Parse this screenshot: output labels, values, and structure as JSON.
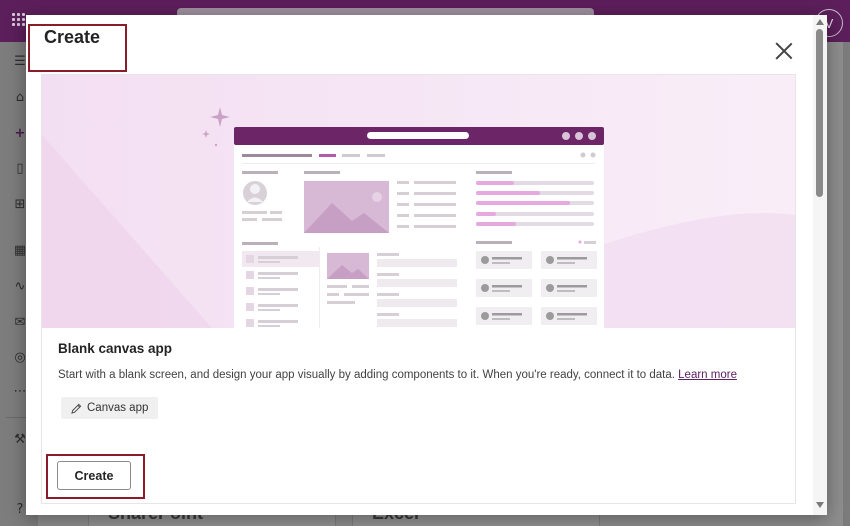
{
  "app": {
    "avatar_initial": "V"
  },
  "background": {
    "cards": [
      "SharePoint",
      "Excel"
    ]
  },
  "dialog": {
    "title": "Create",
    "close_label": "Close"
  },
  "template_card": {
    "title": "Blank canvas app",
    "description": "Start with a blank screen, and design your app visually by adding components to it. When you're ready, connect it to data.",
    "learn_more": "Learn more",
    "chip_label": "Canvas app",
    "create_button": "Create"
  },
  "colors": {
    "brand": "#5c1f5b",
    "hero_bg": "#f6e8f5",
    "highlight_border": "#8b1c2a",
    "link": "#5b2160"
  },
  "icons": [
    "waffle-icon",
    "hamburger-icon",
    "home-icon",
    "plus-icon",
    "book-icon",
    "apps-icon",
    "table-icon",
    "flow-icon",
    "message-icon",
    "globe-icon",
    "more-icon",
    "tools-icon",
    "help-icon",
    "close-icon",
    "pencil-icon",
    "sparkle-icon"
  ]
}
